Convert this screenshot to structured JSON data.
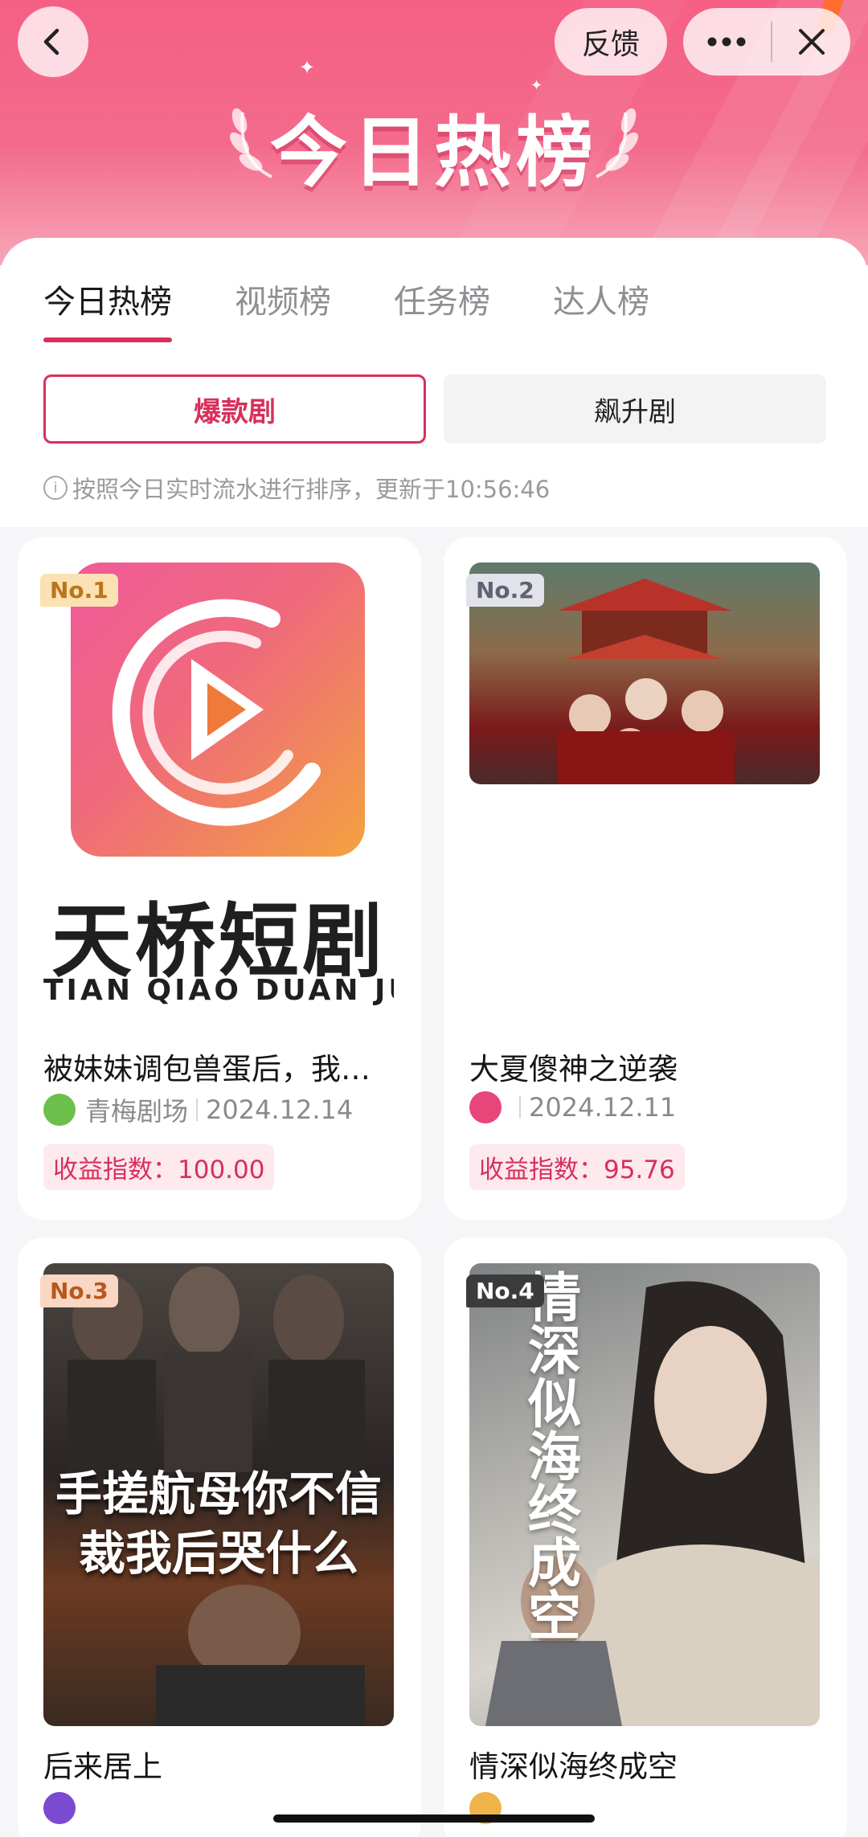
{
  "header": {
    "feedback_label": "反馈",
    "hero_title": "今日热榜",
    "accent": "#f55f84"
  },
  "tabs": [
    {
      "label": "今日热榜",
      "active": true
    },
    {
      "label": "视频榜",
      "active": false
    },
    {
      "label": "任务榜",
      "active": false
    },
    {
      "label": "达人榜",
      "active": false
    }
  ],
  "segments": [
    {
      "label": "爆款剧",
      "active": true
    },
    {
      "label": "飙升剧",
      "active": false
    }
  ],
  "note": "按照今日实时流水进行排序，更新于10:56:46",
  "cards": [
    {
      "rank": "No.1",
      "title": "被妹妹调包兽蛋后，我…",
      "source": "青梅剧场",
      "date": "2024.12.14",
      "income": "收益指数：100.00",
      "logo_cn": "天桥短剧",
      "logo_en": "TIAN QIAO DUAN JU",
      "avatar_color": "#4caf50"
    },
    {
      "rank": "No.2",
      "title": "大夏傻神之逆袭",
      "source": "",
      "date": "2024.12.11",
      "income": "收益指数：95.76",
      "avatar_color": "#e8457a"
    },
    {
      "rank": "No.3",
      "title": "后来居上",
      "poster_text": "手搓航母你不信裁我后哭什么"
    },
    {
      "rank": "No.4",
      "title": "情深似海终成空",
      "poster_text": "情深似海终成空"
    }
  ],
  "colors": {
    "brand": "#d7305c",
    "badge_bg": "#fde9ee"
  }
}
